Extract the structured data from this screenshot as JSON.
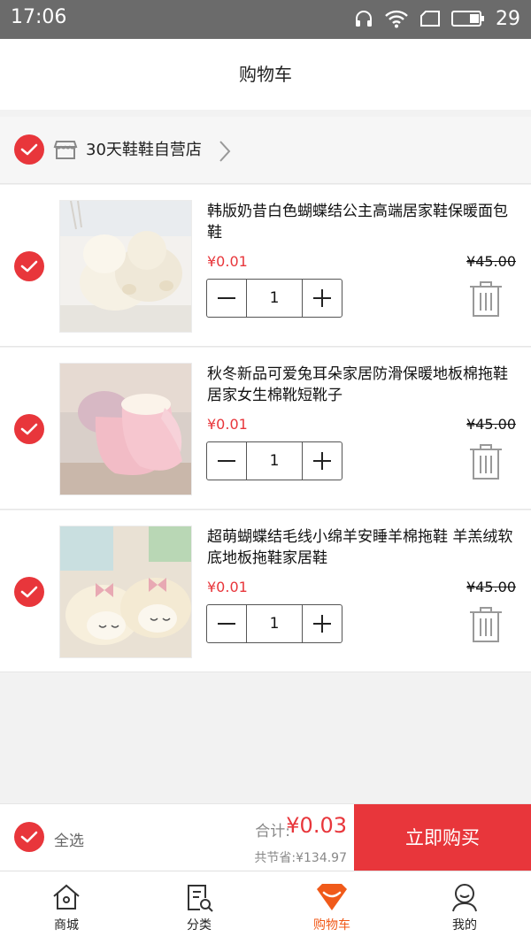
{
  "status_bar": {
    "time": "17:06",
    "battery": "29"
  },
  "header": {
    "title": "购物车"
  },
  "store": {
    "name": "30天鞋鞋自营店"
  },
  "items": [
    {
      "name": " 韩版奶昔白色蝴蝶结公主高端居家鞋保暖面包鞋",
      "price": "¥0.01",
      "original_price": "¥45.00",
      "quantity": "1"
    },
    {
      "name": "秋冬新品可爱兔耳朵家居防滑保暖地板棉拖鞋居家女生棉靴短靴子",
      "price": "¥0.01",
      "original_price": "¥45.00",
      "quantity": "1"
    },
    {
      "name": "超萌蝴蝶结毛线小绵羊安睡羊棉拖鞋 羊羔绒软底地板拖鞋家居鞋",
      "price": "¥0.01",
      "original_price": "¥45.00",
      "quantity": "1"
    }
  ],
  "summary": {
    "select_all": "全选",
    "total_label": "合计:",
    "total_value": "¥0.03",
    "saved": "共节省:¥134.97",
    "buy_button": "立即购买"
  },
  "tabs": [
    {
      "label": "商城",
      "icon": "home-icon"
    },
    {
      "label": "分类",
      "icon": "category-search-icon"
    },
    {
      "label": "购物车",
      "icon": "cart-icon",
      "active": true
    },
    {
      "label": "我的",
      "icon": "profile-icon"
    }
  ],
  "colors": {
    "accent": "#e8363b",
    "active_tab": "#f05a1a"
  }
}
